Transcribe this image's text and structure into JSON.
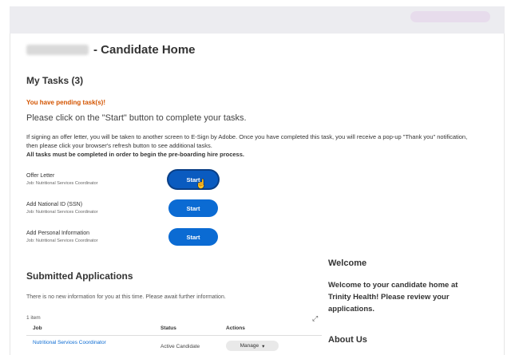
{
  "page": {
    "title": "- Candidate Home",
    "tasks_heading": "My Tasks (3)",
    "pending_text": "You have pending task(s)!",
    "instruction": "Please click on the \"Start\" button to complete your tasks.",
    "note_line1": "If signing an offer letter, you will be taken to another screen to E-Sign by Adobe. Once you have completed this task, you will receive a pop-up \"Thank you\" notification, then please click your browser's refresh button to see additional tasks.",
    "note_line2": "All tasks must be completed in order to begin the pre-boarding hire process."
  },
  "tasks": [
    {
      "name": "Offer Letter",
      "job": "Job: Nutritional Services Coordinator",
      "button": "Start"
    },
    {
      "name": "Add National ID (SSN)",
      "job": "Job: Nutritional Services Coordinator",
      "button": "Start"
    },
    {
      "name": "Add Personal Information",
      "job": "Job: Nutritional Services Coordinator",
      "button": "Start"
    }
  ],
  "submitted": {
    "heading": "Submitted Applications",
    "info": "There is no new information for you at this time. Please await further information.",
    "count": "1 item",
    "columns": [
      "Job",
      "Status",
      "Actions"
    ],
    "rows": [
      {
        "job": "Nutritional Services Coordinator",
        "status": "Active Candidate",
        "action": "Manage"
      }
    ]
  },
  "sidebar": {
    "welcome_heading": "Welcome",
    "welcome_text": "Welcome to your candidate home at Trinity Health! Please review your applications.",
    "about_heading": "About Us"
  },
  "icons": {
    "expand": "expand-icon",
    "dropdown": "chevron-down-icon",
    "cursor": "hand-pointer-icon"
  },
  "colors": {
    "accent": "#0b6bd3",
    "pending": "#d35400"
  }
}
